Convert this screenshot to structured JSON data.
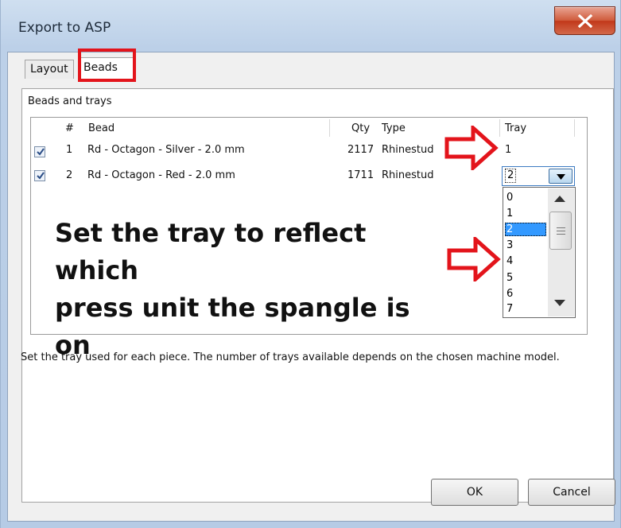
{
  "window": {
    "title": "Export to ASP"
  },
  "tabs": [
    {
      "label": "Layout"
    },
    {
      "label": "Beads"
    }
  ],
  "panel": {
    "group_label": "Beads and trays"
  },
  "list": {
    "columns": {
      "num": "#",
      "bead": "Bead",
      "qty": "Qty",
      "type": "Type",
      "tray": "Tray"
    },
    "rows": [
      {
        "num": "1",
        "bead": "Rd - Octagon - Silver - 2.0 mm",
        "qty": "2117",
        "type": "Rhinestud",
        "tray": "1",
        "checked": true
      },
      {
        "num": "2",
        "bead": "Rd - Octagon - Red - 2.0 mm",
        "qty": "1711",
        "type": "Rhinestud",
        "tray": "2",
        "checked": true
      }
    ]
  },
  "tray_combo": {
    "value": "2",
    "options": [
      "0",
      "1",
      "2",
      "3",
      "4",
      "5",
      "6",
      "7"
    ],
    "selected": "2"
  },
  "annotation": {
    "line1": "Set the tray to reflect which",
    "line2": "press unit the spangle is on",
    "color": "#e3141b"
  },
  "description": "Set the tray used for each piece. The number of trays available depends on the chosen machine model.",
  "buttons": {
    "ok": "OK",
    "cancel": "Cancel"
  },
  "icons": {
    "close": "close-icon",
    "dropdown": "chevron-down-icon",
    "check": "check-icon"
  }
}
